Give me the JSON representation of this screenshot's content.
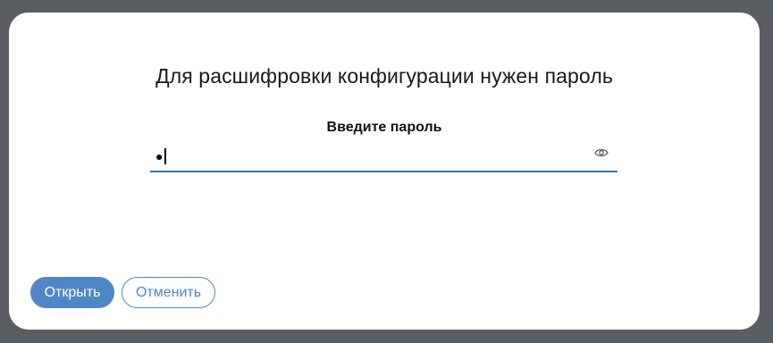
{
  "dialog": {
    "title": "Для расшифровки конфигурации нужен пароль",
    "password_label": "Введите пароль",
    "password_value_masked": "●",
    "show_password_icon": "eye-icon",
    "open_button_label": "Открыть",
    "cancel_button_label": "Отменить"
  },
  "colors": {
    "backdrop": "#5a5e63",
    "accent": "#4f86c6",
    "underline": "#2f72a8"
  }
}
